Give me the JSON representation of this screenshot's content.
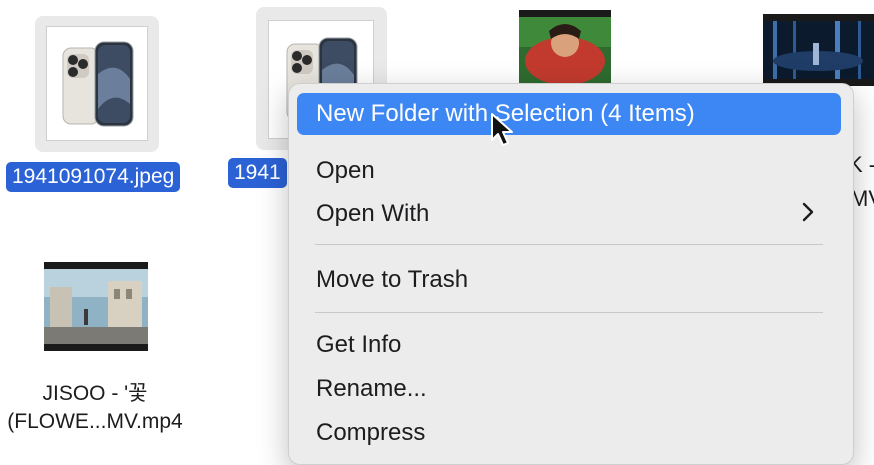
{
  "files": [
    {
      "name": "1941091074.jpeg",
      "selected": true
    },
    {
      "name": "1941",
      "selected": true
    },
    {
      "name": "",
      "selected": false
    },
    {
      "name": "",
      "selected": false
    },
    {
      "name_line1": "JISOO - '꽃",
      "name_line2": "(FLOWE...MV.mp4",
      "selected": false
    }
  ],
  "partial_labels": {
    "line1": "K -",
    "line2": "MV"
  },
  "context_menu": {
    "items": [
      {
        "label": "New Folder with Selection (4 Items)",
        "highlighted": true
      },
      {
        "label": "Open"
      },
      {
        "label": "Open With",
        "submenu_icon": "chevron-right-icon"
      },
      {
        "label": "Move to Trash"
      },
      {
        "label": "Get Info"
      },
      {
        "label": "Rename..."
      },
      {
        "label": "Compress"
      }
    ]
  },
  "colors": {
    "selection": "#2b62d6",
    "menu_highlight": "#3d87f5",
    "menu_bg": "#ececec"
  }
}
